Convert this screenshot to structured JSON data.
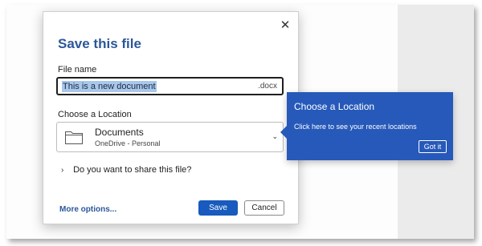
{
  "dialog": {
    "title": "Save this file",
    "close_glyph": "✕",
    "file_name_label": "File name",
    "file_name_value": "This is a new document",
    "file_extension": ".docx",
    "location_label": "Choose a Location",
    "location": {
      "icon": "folder-icon",
      "name": "Documents",
      "subtitle": "OneDrive - Personal",
      "chevron": "⌄"
    },
    "share_prompt": "Do you want to share this file?",
    "share_chevron": "›",
    "more_options": "More options...",
    "save_label": "Save",
    "cancel_label": "Cancel",
    "accent_color": "#185abd"
  },
  "tooltip": {
    "title": "Choose a Location",
    "text": "Click here to see your recent locations",
    "button": "Got it",
    "color": "#2659b9"
  }
}
